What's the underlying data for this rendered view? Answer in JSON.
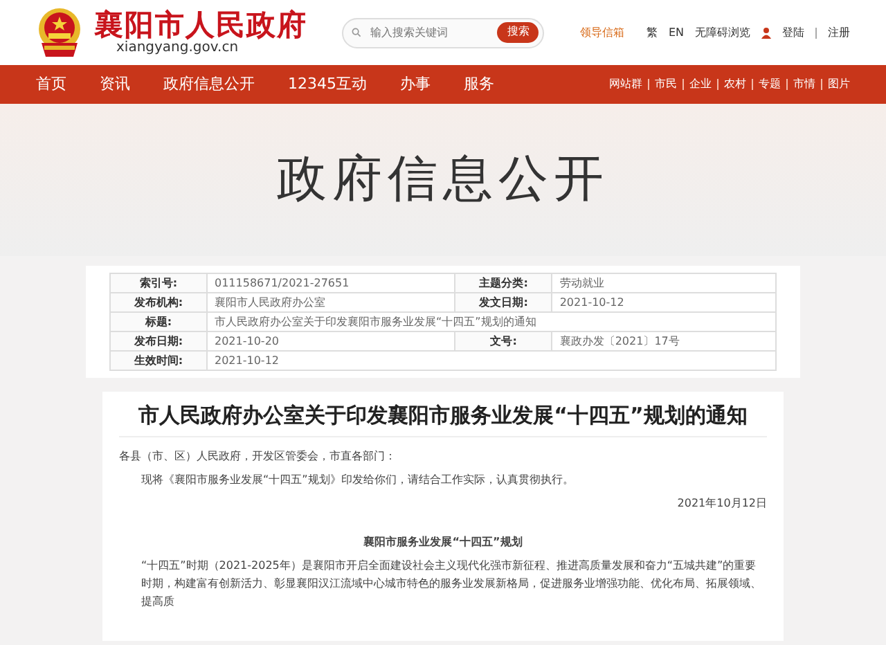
{
  "header": {
    "site_title": "襄阳市人民政府",
    "site_url": "xiangyang.gov.cn",
    "search": {
      "placeholder": "输入搜索关键词",
      "button": "搜索"
    },
    "links": [
      {
        "label": "领导信箱",
        "kind": "highlight"
      },
      {
        "label": "繁",
        "kind": "plain"
      },
      {
        "label": "EN",
        "kind": "plain"
      },
      {
        "label": "无障碍浏览",
        "kind": "plain"
      },
      {
        "label": "登陆",
        "kind": "user"
      },
      {
        "label": "注册",
        "kind": "plain"
      }
    ]
  },
  "nav": {
    "items": [
      "首页",
      "资讯",
      "政府信息公开",
      "12345互动",
      "办事",
      "服务"
    ],
    "right_items": [
      "网站群",
      "市民",
      "企业",
      "农村",
      "专题",
      "市情",
      "图片"
    ]
  },
  "banner": {
    "title": "政府信息公开"
  },
  "info_table": {
    "rows": [
      {
        "cells": [
          {
            "label": "索引号:",
            "value": "011158671/2021-27651"
          },
          {
            "label": "主题分类:",
            "value": "劳动就业"
          }
        ]
      },
      {
        "cells": [
          {
            "label": "发布机构:",
            "value": "襄阳市人民政府办公室"
          },
          {
            "label": "发文日期:",
            "value": "2021-10-12"
          }
        ]
      },
      {
        "cells": [
          {
            "label": "标题:",
            "value": "市人民政府办公室关于印发襄阳市服务业发展“十四五”规划的通知"
          }
        ]
      },
      {
        "cells": [
          {
            "label": "发布日期:",
            "value": "2021-10-20"
          },
          {
            "label": "文号:",
            "value": "襄政办发〔2021〕17号"
          }
        ]
      },
      {
        "cells": [
          {
            "label": "生效时间:",
            "value": "2021-10-12"
          }
        ]
      }
    ]
  },
  "article": {
    "title": "市人民政府办公室关于印发襄阳市服务业发展“十四五”规划的通知",
    "paragraphs": [
      {
        "kind": "salutation",
        "text": "各县（市、区）人民政府，开发区管委会，市直各部门："
      },
      {
        "kind": "body",
        "text": "现将《襄阳市服务业发展“十四五”规划》印发给你们，请结合工作实际，认真贯彻执行。"
      },
      {
        "kind": "date",
        "text": "2021年10月12日"
      },
      {
        "kind": "subtitle",
        "text": "襄阳市服务业发展“十四五”规划"
      },
      {
        "kind": "body",
        "text": "“十四五”时期（2021-2025年）是襄阳市开启全面建设社会主义现代化强市新征程、推进高质量发展和奋力“五城共建”的重要时期，构建富有创新活力、彰显襄阳汉江流域中心城市特色的服务业发展新格局，促进服务业增强功能、优化布局、拓展领域、提高质"
      }
    ]
  }
}
